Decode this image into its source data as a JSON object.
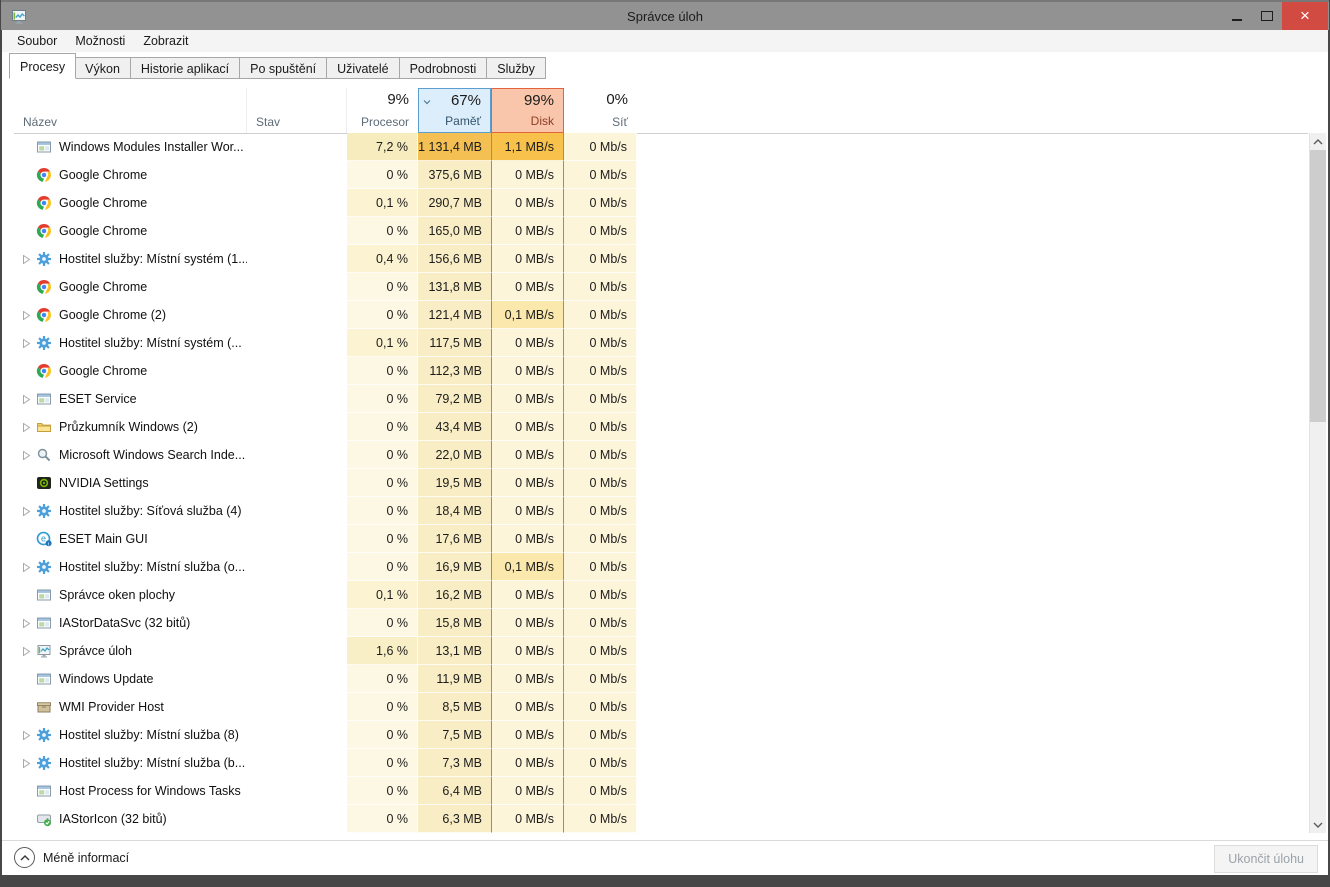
{
  "window": {
    "title": "Správce úloh"
  },
  "menu": {
    "items": [
      "Soubor",
      "Možnosti",
      "Zobrazit"
    ]
  },
  "tabs": [
    {
      "key": "procesy",
      "label": "Procesy",
      "active": true
    },
    {
      "key": "vykon",
      "label": "Výkon",
      "active": false
    },
    {
      "key": "historie-aplikaci",
      "label": "Historie aplikací",
      "active": false
    },
    {
      "key": "po-spusteni",
      "label": "Po spuštění",
      "active": false
    },
    {
      "key": "uzivatele",
      "label": "Uživatelé",
      "active": false
    },
    {
      "key": "podrobnosti",
      "label": "Podrobnosti",
      "active": false
    },
    {
      "key": "sluzby",
      "label": "Služby",
      "active": false
    }
  ],
  "header": {
    "name_label": "Název",
    "status_label": "Stav",
    "cols": [
      {
        "key": "cpu",
        "pct": "9%",
        "label": "Procesor"
      },
      {
        "key": "mem",
        "pct": "67%",
        "label": "Paměť",
        "sorted": true
      },
      {
        "key": "disk",
        "pct": "99%",
        "label": "Disk",
        "hot": true
      },
      {
        "key": "net",
        "pct": "0%",
        "label": "Síť"
      }
    ]
  },
  "palette": {
    "c0": "#fdf8e3",
    "c1": "#fbf3d1",
    "c2": "#f9efc7",
    "c3": "#f7ecbd",
    "m1": "#f8edc4",
    "m3": "#f4c053",
    "d0": "#fdf5da",
    "d1": "#fae8ac",
    "d3": "#f7c14b",
    "n0": "#fdf5da"
  },
  "colors": {
    "titlebar": "#929292",
    "close_button": "#d24b42",
    "mem_header_bg": "#dceefb",
    "mem_header_border": "#5c9ecf",
    "disk_header_bg": "#f9c5ab",
    "disk_header_border": "#e2633c",
    "disk_column_border": "#e8713f"
  },
  "rows": [
    {
      "name": "Windows Modules Installer Wor...",
      "icon": "window-app",
      "expander": false,
      "status": "",
      "cpu": "7,2 %",
      "mem": "1 131,4 MB",
      "disk": "1,1 MB/s",
      "net": "0 Mb/s",
      "heat": [
        "c3",
        "m3",
        "d3",
        "n0"
      ]
    },
    {
      "name": "Google Chrome",
      "icon": "chrome",
      "expander": false,
      "status": "",
      "cpu": "0 %",
      "mem": "375,6 MB",
      "disk": "0 MB/s",
      "net": "0 Mb/s",
      "heat": [
        "c0",
        "m1",
        "d0",
        "n0"
      ]
    },
    {
      "name": "Google Chrome",
      "icon": "chrome",
      "expander": false,
      "status": "",
      "cpu": "0,1 %",
      "mem": "290,7 MB",
      "disk": "0 MB/s",
      "net": "0 Mb/s",
      "heat": [
        "c1",
        "m1",
        "d0",
        "n0"
      ]
    },
    {
      "name": "Google Chrome",
      "icon": "chrome",
      "expander": false,
      "status": "",
      "cpu": "0 %",
      "mem": "165,0 MB",
      "disk": "0 MB/s",
      "net": "0 Mb/s",
      "heat": [
        "c0",
        "m1",
        "d0",
        "n0"
      ]
    },
    {
      "name": "Hostitel služby: Místní systém (1...",
      "icon": "services-gear",
      "expander": true,
      "status": "",
      "cpu": "0,4 %",
      "mem": "156,6 MB",
      "disk": "0 MB/s",
      "net": "0 Mb/s",
      "heat": [
        "c1",
        "m1",
        "d0",
        "n0"
      ]
    },
    {
      "name": "Google Chrome",
      "icon": "chrome",
      "expander": false,
      "status": "",
      "cpu": "0 %",
      "mem": "131,8 MB",
      "disk": "0 MB/s",
      "net": "0 Mb/s",
      "heat": [
        "c0",
        "m1",
        "d0",
        "n0"
      ]
    },
    {
      "name": "Google Chrome (2)",
      "icon": "chrome",
      "expander": true,
      "status": "",
      "cpu": "0 %",
      "mem": "121,4 MB",
      "disk": "0,1 MB/s",
      "net": "0 Mb/s",
      "heat": [
        "c0",
        "m1",
        "d1",
        "n0"
      ]
    },
    {
      "name": "Hostitel služby: Místní systém (...",
      "icon": "services-gear",
      "expander": true,
      "status": "",
      "cpu": "0,1 %",
      "mem": "117,5 MB",
      "disk": "0 MB/s",
      "net": "0 Mb/s",
      "heat": [
        "c1",
        "m1",
        "d0",
        "n0"
      ]
    },
    {
      "name": "Google Chrome",
      "icon": "chrome",
      "expander": false,
      "status": "",
      "cpu": "0 %",
      "mem": "112,3 MB",
      "disk": "0 MB/s",
      "net": "0 Mb/s",
      "heat": [
        "c0",
        "m1",
        "d0",
        "n0"
      ]
    },
    {
      "name": "ESET Service",
      "icon": "window-app",
      "expander": true,
      "status": "",
      "cpu": "0 %",
      "mem": "79,2 MB",
      "disk": "0 MB/s",
      "net": "0 Mb/s",
      "heat": [
        "c0",
        "m1",
        "d0",
        "n0"
      ]
    },
    {
      "name": "Průzkumník Windows (2)",
      "icon": "folder",
      "expander": true,
      "status": "",
      "cpu": "0 %",
      "mem": "43,4 MB",
      "disk": "0 MB/s",
      "net": "0 Mb/s",
      "heat": [
        "c0",
        "m1",
        "d0",
        "n0"
      ]
    },
    {
      "name": "Microsoft Windows Search Inde...",
      "icon": "search",
      "expander": true,
      "status": "",
      "cpu": "0 %",
      "mem": "22,0 MB",
      "disk": "0 MB/s",
      "net": "0 Mb/s",
      "heat": [
        "c0",
        "m1",
        "d0",
        "n0"
      ]
    },
    {
      "name": "NVIDIA Settings",
      "icon": "nvidia",
      "expander": false,
      "status": "",
      "cpu": "0 %",
      "mem": "19,5 MB",
      "disk": "0 MB/s",
      "net": "0 Mb/s",
      "heat": [
        "c0",
        "m1",
        "d0",
        "n0"
      ]
    },
    {
      "name": "Hostitel služby: Síťová služba (4)",
      "icon": "services-gear",
      "expander": true,
      "status": "",
      "cpu": "0 %",
      "mem": "18,4 MB",
      "disk": "0 MB/s",
      "net": "0 Mb/s",
      "heat": [
        "c0",
        "m1",
        "d0",
        "n0"
      ]
    },
    {
      "name": "ESET Main GUI",
      "icon": "eset",
      "expander": false,
      "status": "",
      "cpu": "0 %",
      "mem": "17,6 MB",
      "disk": "0 MB/s",
      "net": "0 Mb/s",
      "heat": [
        "c0",
        "m1",
        "d0",
        "n0"
      ]
    },
    {
      "name": "Hostitel služby: Místní služba (o...",
      "icon": "services-gear",
      "expander": true,
      "status": "",
      "cpu": "0 %",
      "mem": "16,9 MB",
      "disk": "0,1 MB/s",
      "net": "0 Mb/s",
      "heat": [
        "c0",
        "m1",
        "d1",
        "n0"
      ]
    },
    {
      "name": "Správce oken plochy",
      "icon": "window-app",
      "expander": false,
      "status": "",
      "cpu": "0,1 %",
      "mem": "16,2 MB",
      "disk": "0 MB/s",
      "net": "0 Mb/s",
      "heat": [
        "c1",
        "m1",
        "d0",
        "n0"
      ]
    },
    {
      "name": "IAStorDataSvc (32 bitů)",
      "icon": "window-app",
      "expander": true,
      "status": "",
      "cpu": "0 %",
      "mem": "15,8 MB",
      "disk": "0 MB/s",
      "net": "0 Mb/s",
      "heat": [
        "c0",
        "m1",
        "d0",
        "n0"
      ]
    },
    {
      "name": "Správce úloh",
      "icon": "taskmgr",
      "expander": true,
      "status": "",
      "cpu": "1,6 %",
      "mem": "13,1 MB",
      "disk": "0 MB/s",
      "net": "0 Mb/s",
      "heat": [
        "c2",
        "m1",
        "d0",
        "n0"
      ]
    },
    {
      "name": "Windows Update",
      "icon": "window-app",
      "expander": false,
      "status": "",
      "cpu": "0 %",
      "mem": "11,9 MB",
      "disk": "0 MB/s",
      "net": "0 Mb/s",
      "heat": [
        "c0",
        "m1",
        "d0",
        "n0"
      ]
    },
    {
      "name": "WMI Provider Host",
      "icon": "wmi",
      "expander": false,
      "status": "",
      "cpu": "0 %",
      "mem": "8,5 MB",
      "disk": "0 MB/s",
      "net": "0 Mb/s",
      "heat": [
        "c0",
        "m1",
        "d0",
        "n0"
      ]
    },
    {
      "name": "Hostitel služby: Místní služba (8)",
      "icon": "services-gear",
      "expander": true,
      "status": "",
      "cpu": "0 %",
      "mem": "7,5 MB",
      "disk": "0 MB/s",
      "net": "0 Mb/s",
      "heat": [
        "c0",
        "m1",
        "d0",
        "n0"
      ]
    },
    {
      "name": "Hostitel služby: Místní služba (b...",
      "icon": "services-gear",
      "expander": true,
      "status": "",
      "cpu": "0 %",
      "mem": "7,3 MB",
      "disk": "0 MB/s",
      "net": "0 Mb/s",
      "heat": [
        "c0",
        "m1",
        "d0",
        "n0"
      ]
    },
    {
      "name": "Host Process for Windows Tasks",
      "icon": "window-app",
      "expander": false,
      "status": "",
      "cpu": "0 %",
      "mem": "6,4 MB",
      "disk": "0 MB/s",
      "net": "0 Mb/s",
      "heat": [
        "c0",
        "m1",
        "d0",
        "n0"
      ]
    },
    {
      "name": "IAStorIcon (32 bitů)",
      "icon": "iastor",
      "expander": false,
      "status": "",
      "cpu": "0 %",
      "mem": "6,3 MB",
      "disk": "0 MB/s",
      "net": "0 Mb/s",
      "heat": [
        "c0",
        "m1",
        "d0",
        "n0"
      ]
    }
  ],
  "footer": {
    "less_info": "Méně informací",
    "end_task": "Ukončit úlohu"
  }
}
